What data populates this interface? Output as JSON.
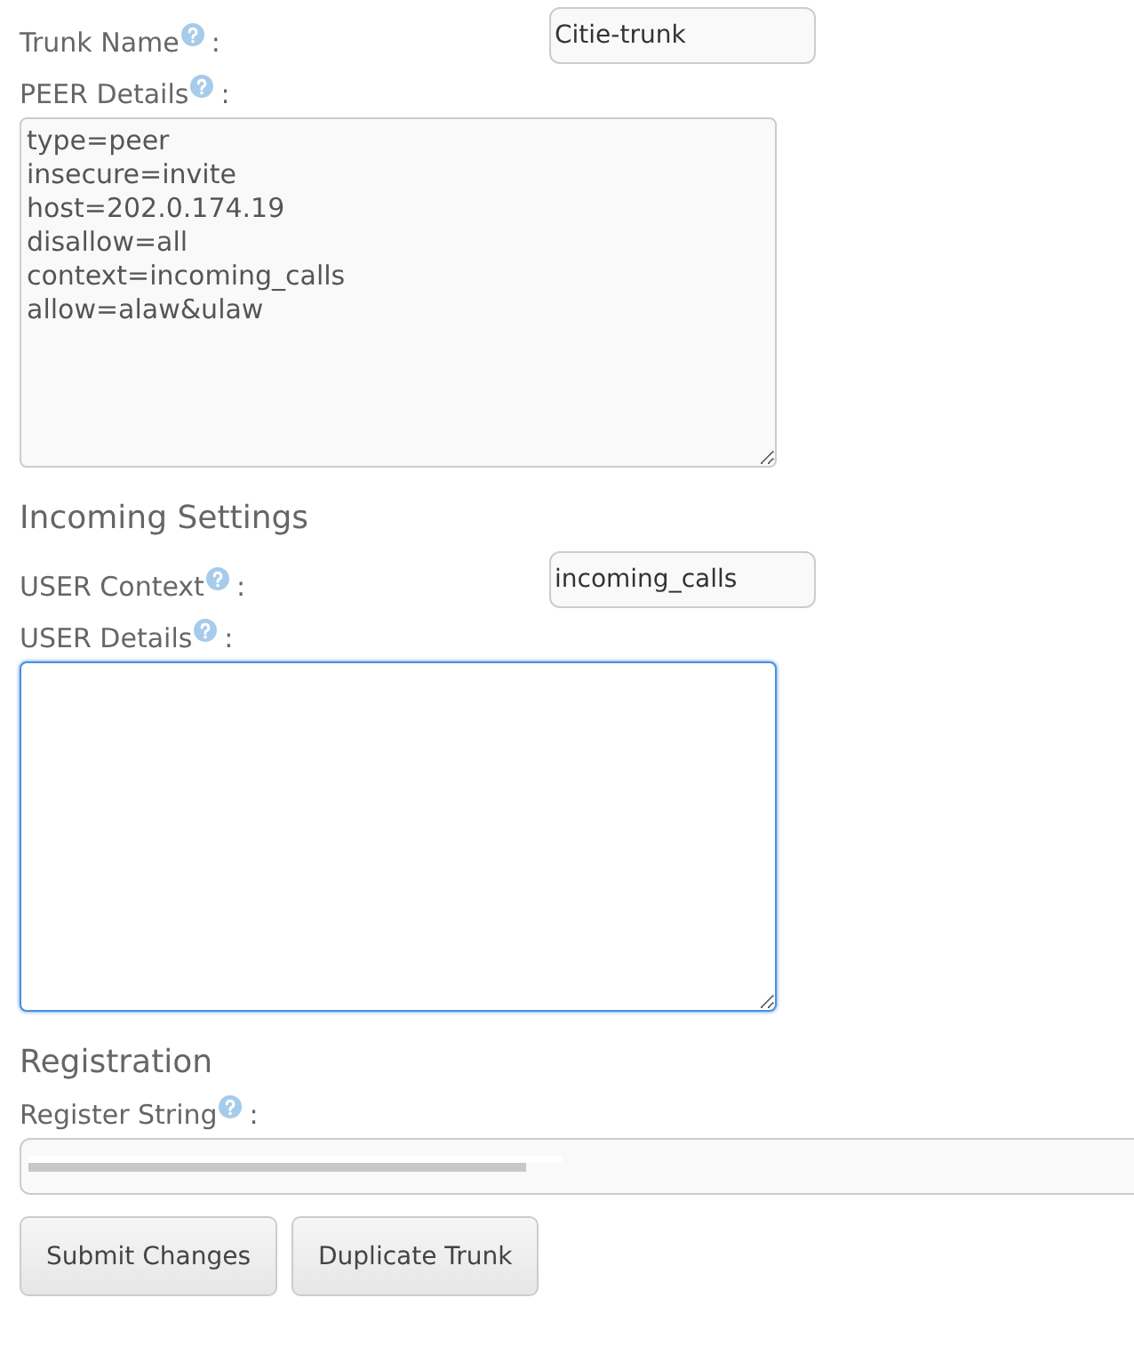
{
  "sections": [
    {
      "kind": "input",
      "label": "Trunk Name",
      "colon": ":",
      "value": "Citie-trunk",
      "help": true
    },
    {
      "kind": "textarea",
      "label": "PEER Details",
      "colon": ":",
      "value": "type=peer\ninsecure=invite\nhost=202.0.174.19\ndisallow=all\ncontext=incoming_calls\nallow=alaw&ulaw",
      "focused": false,
      "help": true
    },
    {
      "kind": "heading",
      "text": "Incoming Settings"
    },
    {
      "kind": "input",
      "label": "USER Context",
      "colon": ":",
      "value": "incoming_calls",
      "help": true
    },
    {
      "kind": "textarea",
      "label": "USER Details",
      "colon": ":",
      "focused": true,
      "help": true
    },
    {
      "kind": "heading",
      "text": "Registration"
    },
    {
      "kind": "wide-input",
      "label": "Register String",
      "colon": ":",
      "redacted": true,
      "help": true
    }
  ],
  "buttons": [
    "Submit Changes",
    "Duplicate Trunk"
  ]
}
